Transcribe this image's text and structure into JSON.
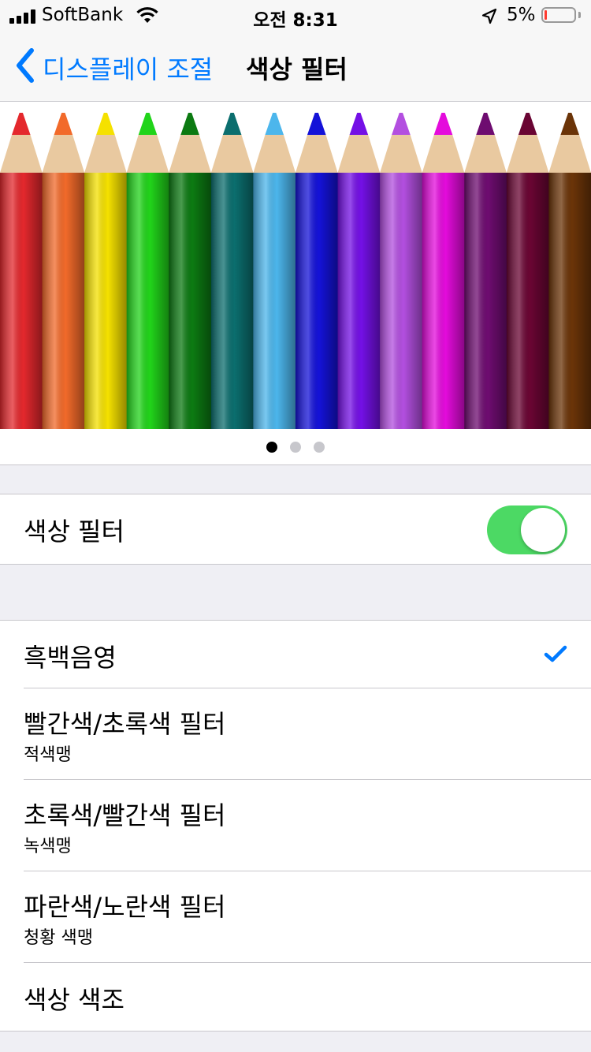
{
  "status_bar": {
    "carrier": "SoftBank",
    "time": "오전 8:31",
    "battery_percent": "5%",
    "icons": [
      "signal-icon",
      "wifi-icon",
      "location-icon",
      "battery-icon"
    ]
  },
  "nav": {
    "back_label": "디스플레이 조절",
    "title": "색상 필터",
    "back_icon": "chevron-left-icon"
  },
  "preview": {
    "page_count": 3,
    "active_page": 1,
    "pencil_colors": [
      "#e4282d",
      "#f26a2a",
      "#f5e100",
      "#21d41a",
      "#0c7a12",
      "#0b6e6e",
      "#4cb6ec",
      "#1412d8",
      "#7410e6",
      "#b34fe0",
      "#e40bdc",
      "#6e0c70",
      "#6a0533",
      "#6b3408"
    ]
  },
  "filter_toggle": {
    "label": "색상 필터",
    "on": true
  },
  "options": [
    {
      "label": "흑백음영",
      "sub": "",
      "selected": true
    },
    {
      "label": "빨간색/초록색 필터",
      "sub": "적색맹",
      "selected": false
    },
    {
      "label": "초록색/빨간색 필터",
      "sub": "녹색맹",
      "selected": false
    },
    {
      "label": "파란색/노란색 필터",
      "sub": "청황 색맹",
      "selected": false
    },
    {
      "label": "색상 색조",
      "sub": "",
      "selected": false
    }
  ],
  "colors": {
    "accent": "#007aff",
    "toggle_on": "#4cd964",
    "background": "#efeff4"
  }
}
